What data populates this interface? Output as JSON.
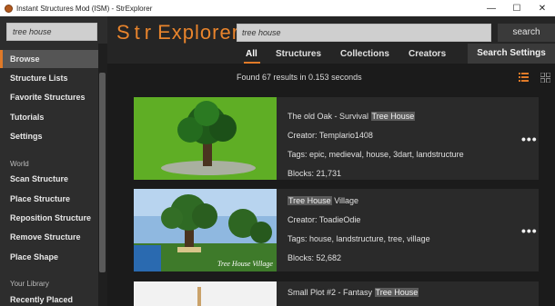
{
  "window": {
    "title": "Instant Structures Mod (ISM) - StrExplorer",
    "minimize": "—",
    "maximize": "☐",
    "close": "✕"
  },
  "sidebar": {
    "search_value": "tree house",
    "items": [
      {
        "label": "Browse",
        "active": true
      },
      {
        "label": "Structure Lists"
      },
      {
        "label": "Favorite Structures"
      },
      {
        "label": "Tutorials"
      },
      {
        "label": "Settings"
      }
    ],
    "world_section": "World",
    "world_items": [
      {
        "label": "Scan Structure"
      },
      {
        "label": "Place Structure"
      },
      {
        "label": "Reposition Structure"
      },
      {
        "label": "Remove Structure"
      },
      {
        "label": "Place Shape"
      }
    ],
    "library_section": "Your Library",
    "library_items": [
      {
        "label": "Recently Placed"
      }
    ]
  },
  "header": {
    "logo_left": "Str",
    "logo_right": "Explorer",
    "search_value": "tree house",
    "search_button": "search",
    "tabs": [
      "All",
      "Structures",
      "Collections",
      "Creators"
    ],
    "search_settings": "Search Settings"
  },
  "results": {
    "summary": "Found 67 results in 0.153 seconds",
    "more_label": "•••",
    "items": [
      {
        "title_pre": "The old Oak - Survival ",
        "title_hl": "Tree House",
        "title_post": "",
        "creator": "Creator: Templario1408",
        "tags": "Tags: epic, medieval, house, 3dart, landstructure",
        "blocks": "Blocks: 21,731"
      },
      {
        "title_pre": "",
        "title_hl": "Tree House",
        "title_post": " Village",
        "creator": "Creator: ToadieOdie",
        "tags": "Tags: house, landstructure, tree, village",
        "blocks": "Blocks: 52,682",
        "thumb_caption": "Tree House Village"
      },
      {
        "title_pre": "Small Plot #2 - Fantasy ",
        "title_hl": "Tree House",
        "title_post": ""
      }
    ]
  },
  "colors": {
    "accent": "#e07a28",
    "sidebar_bg": "#2d2d2d",
    "main_bg": "#1b1b1b",
    "card_bg": "#2a2a2a"
  }
}
